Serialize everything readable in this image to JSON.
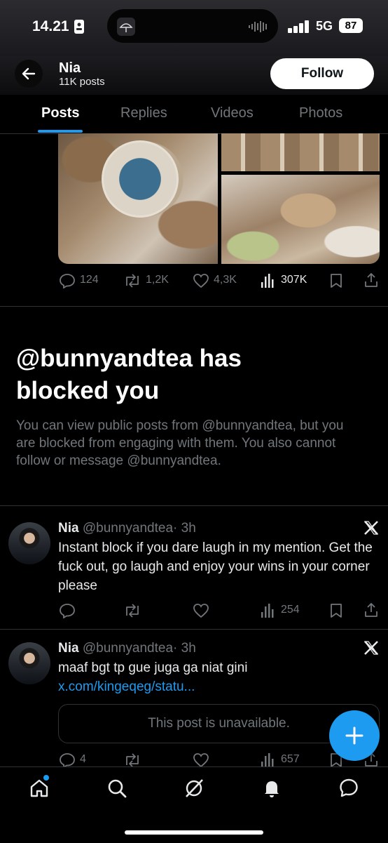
{
  "status_bar": {
    "time": "14.21",
    "network": "5G",
    "battery": "87"
  },
  "header": {
    "name": "Nia",
    "posts": "11K posts",
    "follow_label": "Follow"
  },
  "tabs": [
    {
      "label": "Posts",
      "active": true
    },
    {
      "label": "Replies",
      "active": false
    },
    {
      "label": "Videos",
      "active": false
    },
    {
      "label": "Photos",
      "active": false
    }
  ],
  "top_post_actions": {
    "replies": "124",
    "reposts": "1,2K",
    "likes": "4,3K",
    "views": "307K"
  },
  "blocked": {
    "title": "@bunnyandtea has blocked you",
    "body": "You can view public posts from @bunnyandtea, but you are blocked from engaging with them. You also cannot follow or message @bunnyandtea."
  },
  "tweets": [
    {
      "name": "Nia",
      "handle": "@bunnyandtea",
      "time": "· 3h",
      "text": "Instant block if you dare laugh in my mention. Get the fuck out, go laugh and enjoy your wins in your corner please",
      "views": "254"
    },
    {
      "name": "Nia",
      "handle": "@bunnyandtea",
      "time": "· 3h",
      "text_prefix": "maaf bgt tp gue juga ga niat gini ",
      "link": "x.com/kingeqeg/statu...",
      "quote": "This post is unavailable.",
      "replies": "4",
      "views": "657"
    }
  ],
  "colors": {
    "accent": "#1d9bf0",
    "muted": "#71767b",
    "background": "#000000"
  }
}
